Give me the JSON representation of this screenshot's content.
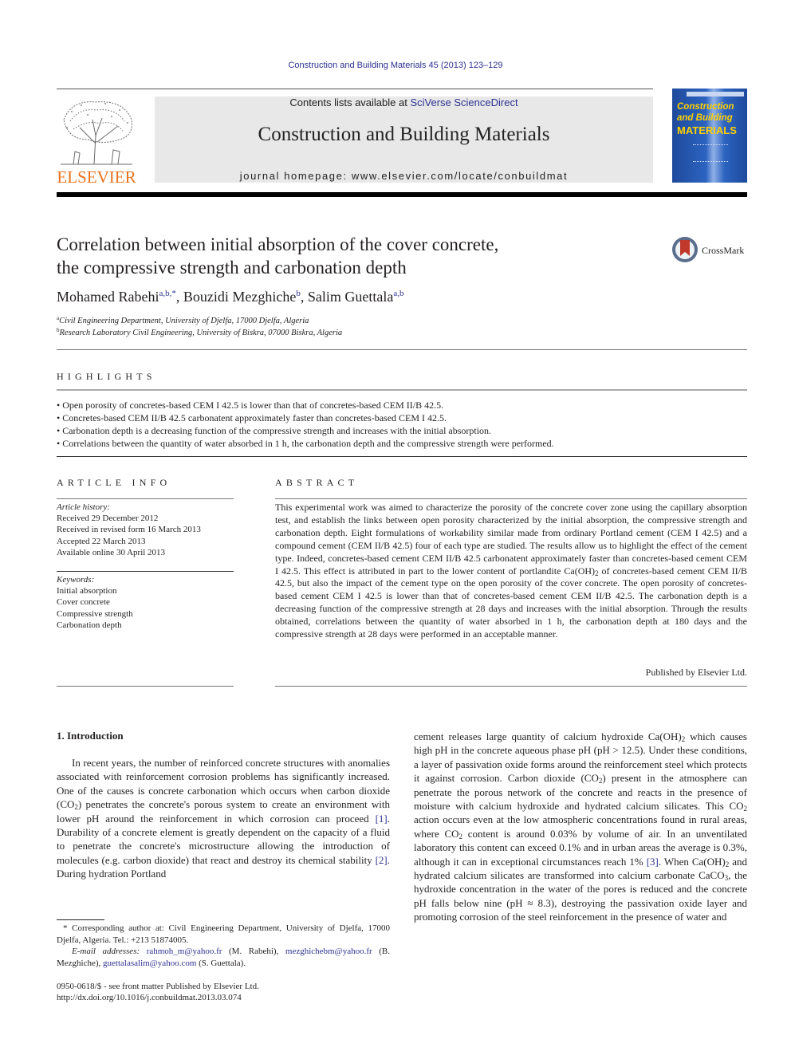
{
  "journal_ref": "Construction and Building Materials 45 (2013) 123–129",
  "header": {
    "publisher_logo_text": "ELSEVIER",
    "contents_prefix": "Contents lists available at ",
    "contents_link": "SciVerse ScienceDirect",
    "journal_title": "Construction and Building Materials",
    "homepage_text": "journal homepage: www.elsevier.com/locate/conbuildmat",
    "cover": {
      "line1": "Construction",
      "line2": "and Building",
      "line3": "MATERIALS",
      "background_color": "#2c63c0",
      "title_color": "#ffd100"
    },
    "publisher_color": "#e9711c",
    "link_color": "#2e3192"
  },
  "article": {
    "title_line1": "Correlation between initial absorption of the cover concrete,",
    "title_line2": "the compressive strength and carbonation depth",
    "crossmark_label": "CrossMark",
    "authors": [
      {
        "name": "Mohamed Rabehi",
        "sup": "a,b,*",
        "sep": ", "
      },
      {
        "name": "Bouzidi Mezghiche",
        "sup": "b",
        "sep": ", "
      },
      {
        "name": "Salim Guettala",
        "sup": "a,b",
        "sep": ""
      }
    ],
    "affiliations": [
      {
        "key": "a",
        "text": "Civil Engineering Department, University of Djelfa, 17000 Djelfa, Algeria"
      },
      {
        "key": "b",
        "text": "Research Laboratory Civil Engineering, University of Biskra, 07000 Biskra, Algeria"
      }
    ]
  },
  "highlights": {
    "heading": "HIGHLIGHTS",
    "items": [
      "Open porosity of concretes-based CEM I 42.5 is lower than that of concretes-based CEM II/B 42.5.",
      "Concretes-based CEM II/B 42.5 carbonatent approximately faster than concretes-based CEM I 42.5.",
      "Carbonation depth is a decreasing function of the compressive strength and increases with the initial absorption.",
      "Correlations between the quantity of water absorbed in 1 h, the carbonation depth and the compressive strength were performed."
    ]
  },
  "article_info": {
    "heading": "ARTICLE INFO",
    "history_label": "Article history:",
    "history": [
      "Received 29 December 2012",
      "Received in revised form 16 March 2013",
      "Accepted 22 March 2013",
      "Available online 30 April 2013"
    ],
    "keywords_label": "Keywords:",
    "keywords": [
      "Initial absorption",
      "Cover concrete",
      "Compressive strength",
      "Carbonation depth"
    ]
  },
  "abstract": {
    "heading": "ABSTRACT",
    "p1": "This experimental work was aimed to characterize the porosity of the concrete cover zone using the capillary absorption test, and establish the links between open porosity characterized by the initial absorption, the compressive strength and carbonation depth. Eight formulations of workability similar made from ordinary Portland cement (CEM I 42.5) and a compound cement (CEM II/B 42.5) four of each type are studied. The results allow us to highlight the effect of the cement type. Indeed, concretes-based cement CEM II/B 42.5 carbonatent approximately faster than concretes-based cement CEM I 42.5. This effect is attributed in part to the lower content of portlandite Ca(OH)",
    "sub1": "2",
    "p2": " of concretes-based cement CEM II/B 42.5, but also the impact of the cement type on the open porosity of the cover concrete. The open porosity of concretes-based cement CEM I 42.5 is lower than that of concretes-based cement CEM II/B 42.5. The carbonation depth is a decreasing function of the compressive strength at 28 days and increases with the initial absorption. Through the results obtained, correlations between the quantity of water absorbed in 1 h, the carbonation depth at 180 days and the compressive strength at 28 days were performed in an acceptable manner.",
    "published_by": "Published by Elsevier Ltd."
  },
  "introduction": {
    "heading": "1. Introduction",
    "left": {
      "t1": "In recent years, the number of reinforced concrete structures with anomalies associated with reinforcement corrosion problems has significantly increased. One of the causes is concrete carbonation which occurs when carbon dioxide (CO",
      "s1": "2",
      "t2": ") penetrates the concrete's porous system to create an environment with lower pH around the reinforcement in which corrosion can proceed ",
      "ref1": "[1]",
      "t3": ". Durability of a concrete element is greatly dependent on the capacity of a fluid to penetrate the concrete's microstructure allowing the introduction of molecules (e.g. carbon dioxide) that react and destroy its chemical stability ",
      "ref2": "[2]",
      "t4": ". During hydration Portland"
    },
    "right": {
      "t1": "cement releases large quantity of calcium hydroxide Ca(OH)",
      "s1": "2",
      "t2": " which causes high pH in the concrete aqueous phase pH (pH > 12.5). Under these conditions, a layer of passivation oxide forms around the reinforcement steel which protects it against corrosion. Carbon dioxide (CO",
      "s2": "2",
      "t3": ") present in the atmosphere can penetrate the porous network of the concrete and reacts in the presence of moisture with calcium hydroxide and hydrated calcium silicates. This CO",
      "s3": "2",
      "t4": " action occurs even at the low atmospheric concentrations found in rural areas, where CO",
      "s4": "2",
      "t5": " content is around 0.03% by volume of air. In an unventilated laboratory this content can exceed 0.1% and in urban areas the average is 0.3%, although it can in exceptional circumstances reach 1% ",
      "ref3": "[3]",
      "t6": ". When Ca(OH)",
      "s5": "2",
      "t7": " and hydrated calcium silicates are transformed into calcium carbonate CaCO",
      "s6": "3",
      "t8": ", the hydroxide concentration in the water of the pores is reduced and the concrete pH falls below nine (pH ≈ 8.3), destroying the passivation oxide layer and promoting corrosion of the steel reinforcement in the presence of water and"
    }
  },
  "footnotes": {
    "corresponding": "* Corresponding author at: Civil Engineering Department, University of Djelfa, 17000 Djelfa, Algeria. Tel.: +213 51874005.",
    "email_label": "E-mail addresses:",
    "emails": [
      {
        "address": "rahmoh_m@yahoo.fr",
        "owner": " (M. Rabehi), "
      },
      {
        "address": "mezghichebm@yahoo.fr",
        "owner": " (B. Mezghiche), "
      },
      {
        "address": "guettalasalim@yahoo.com",
        "owner": " (S. Guettala)."
      }
    ],
    "issn": "0950-0618/$ - see front matter Published by Elsevier Ltd.",
    "doi": "http://dx.doi.org/10.1016/j.conbuildmat.2013.03.074"
  }
}
